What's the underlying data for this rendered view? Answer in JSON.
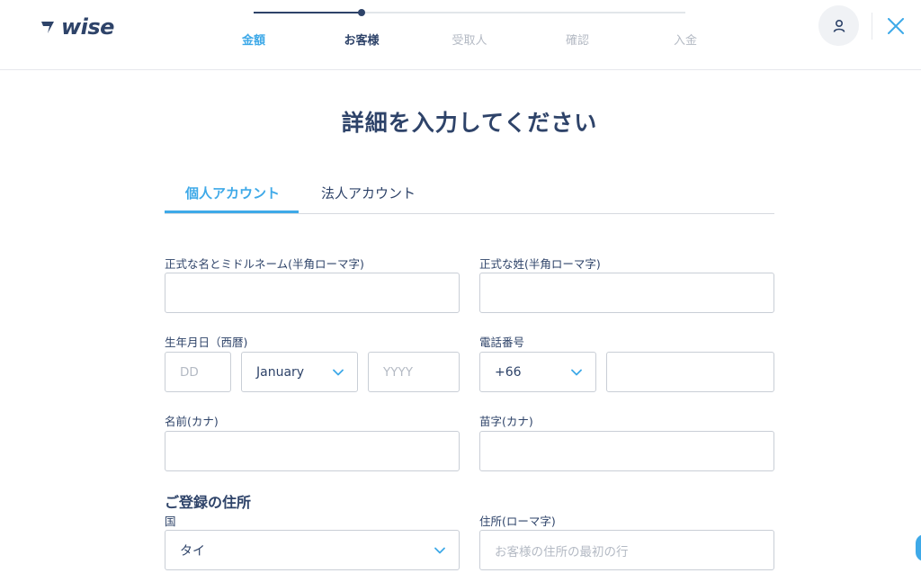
{
  "brand": {
    "name": "wise",
    "color": "#2e4369",
    "accent": "#3ea9e8"
  },
  "header": {
    "steps": [
      {
        "label": "金額",
        "state": "done"
      },
      {
        "label": "お客様",
        "state": "current"
      },
      {
        "label": "受取人",
        "state": "upcoming"
      },
      {
        "label": "確認",
        "state": "upcoming"
      },
      {
        "label": "入金",
        "state": "upcoming"
      }
    ],
    "progress": 0.25,
    "profile_icon": "user-icon",
    "close_icon": "close-icon"
  },
  "main": {
    "title": "詳細を入力してください",
    "tabs": [
      {
        "label": "個人アカウント",
        "active": true
      },
      {
        "label": "法人アカウント",
        "active": false
      }
    ],
    "form": {
      "first_name": {
        "label": "正式な名とミドルネーム(半角ローマ字)",
        "value": ""
      },
      "last_name": {
        "label": "正式な姓(半角ローマ字)",
        "value": ""
      },
      "dob": {
        "label": "生年月日（西暦)",
        "day_placeholder": "DD",
        "month_value": "January",
        "year_placeholder": "YYYY"
      },
      "phone": {
        "label": "電話番号",
        "country_code": "+66",
        "value": ""
      },
      "first_name_kana": {
        "label": "名前(カナ)",
        "value": ""
      },
      "last_name_kana": {
        "label": "苗字(カナ)",
        "value": ""
      },
      "address_section_title": "ご登録の住所",
      "country": {
        "label": "国",
        "value": "タイ"
      },
      "address": {
        "label": "住所(ローマ字)",
        "placeholder": "お客様の住所の最初の行"
      }
    }
  }
}
